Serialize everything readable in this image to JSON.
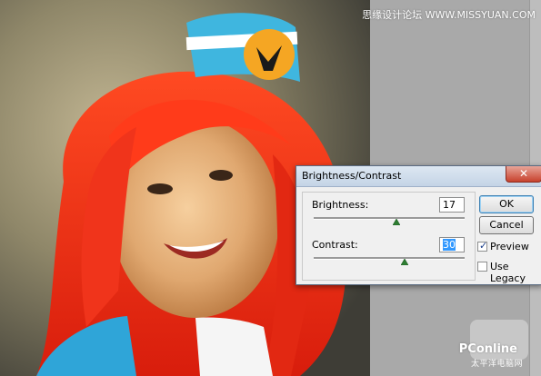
{
  "watermark_top": "思缘设计论坛 WWW.MISSYUAN.COM",
  "logo": {
    "brand": "PConline",
    "sub": "太平洋电脑网"
  },
  "dialog": {
    "title": "Brightness/Contrast",
    "close_symbol": "✕",
    "brightness": {
      "label": "Brightness:",
      "value": "17",
      "slider_fraction": 0.55
    },
    "contrast": {
      "label": "Contrast:",
      "value": "30",
      "slider_fraction": 0.6
    },
    "ok_label": "OK",
    "cancel_label": "Cancel",
    "preview": {
      "label": "Preview",
      "checked": true
    },
    "use_legacy": {
      "label": "Use Legacy",
      "checked": false
    }
  }
}
